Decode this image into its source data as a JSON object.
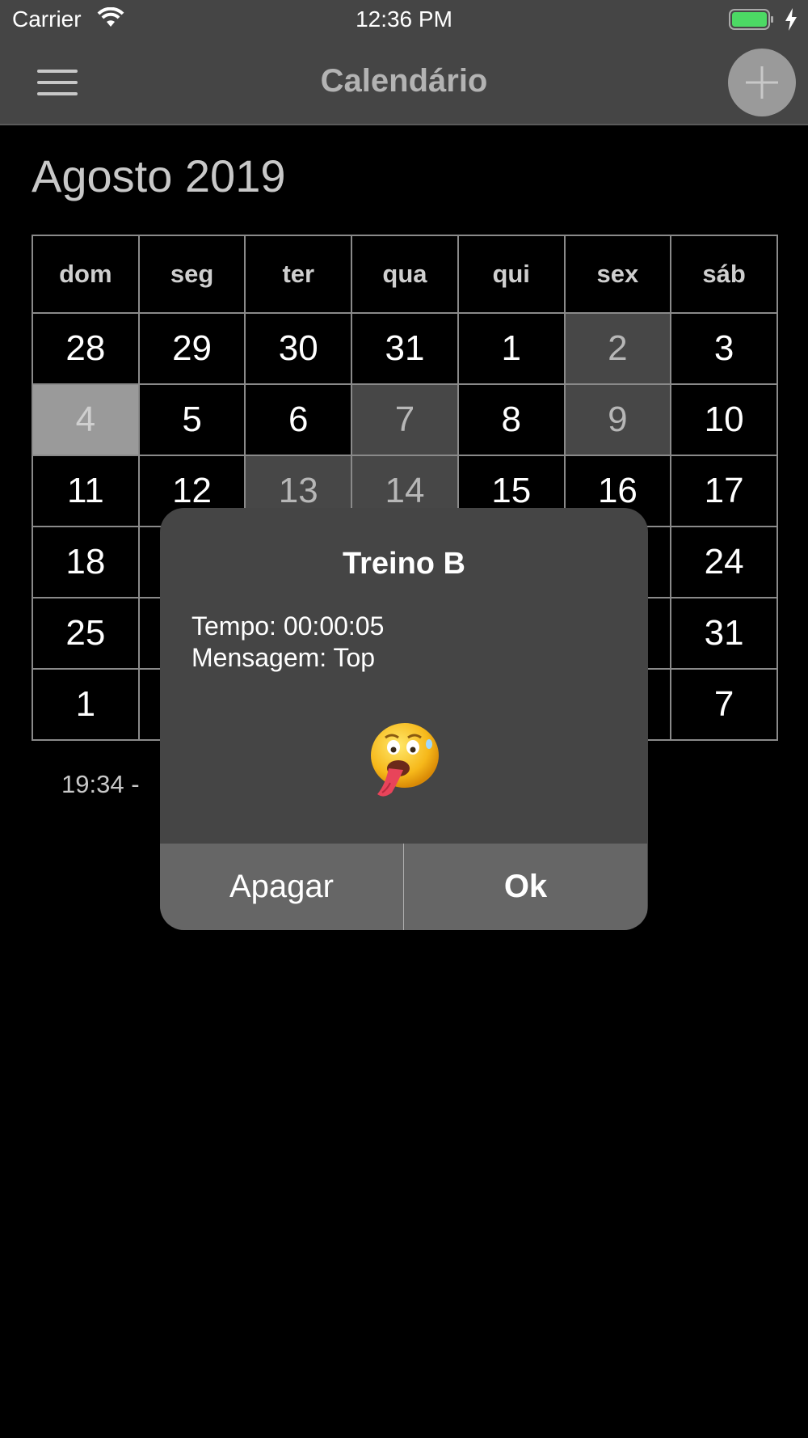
{
  "status_bar": {
    "carrier": "Carrier",
    "time": "12:36 PM"
  },
  "nav": {
    "title": "Calendário",
    "menu_icon": "hamburger-icon",
    "add_icon": "plus-icon"
  },
  "calendar": {
    "month_title": "Agosto 2019",
    "weekdays": [
      "dom",
      "seg",
      "ter",
      "qua",
      "qui",
      "sex",
      "sáb"
    ],
    "weeks": [
      [
        "28",
        "29",
        "30",
        "31",
        "1",
        "2",
        "3"
      ],
      [
        "4",
        "5",
        "6",
        "7",
        "8",
        "9",
        "10"
      ],
      [
        "11",
        "12",
        "13",
        "14",
        "15",
        "16",
        "17"
      ],
      [
        "18",
        "",
        "",
        "",
        "",
        "",
        "24"
      ],
      [
        "25",
        "",
        "",
        "",
        "",
        "",
        "31"
      ],
      [
        "1",
        "",
        "",
        "",
        "",
        "",
        "7"
      ]
    ],
    "colors": {
      "workout_day": "#474747",
      "selected_day": "#9a9a9a",
      "grid": "#8a8a8a"
    },
    "workout_days": [
      "2",
      "7",
      "9",
      "13",
      "14"
    ],
    "selected_day": "4"
  },
  "event_list": {
    "first_entry_partial": "19:34 -"
  },
  "dialog": {
    "title": "Treino B",
    "tempo": "Tempo: 00:00:05",
    "mensagem": "Mensagem: Top",
    "emoji_icon": "exhausted-face-emoji",
    "delete_label": "Apagar",
    "ok_label": "Ok"
  }
}
